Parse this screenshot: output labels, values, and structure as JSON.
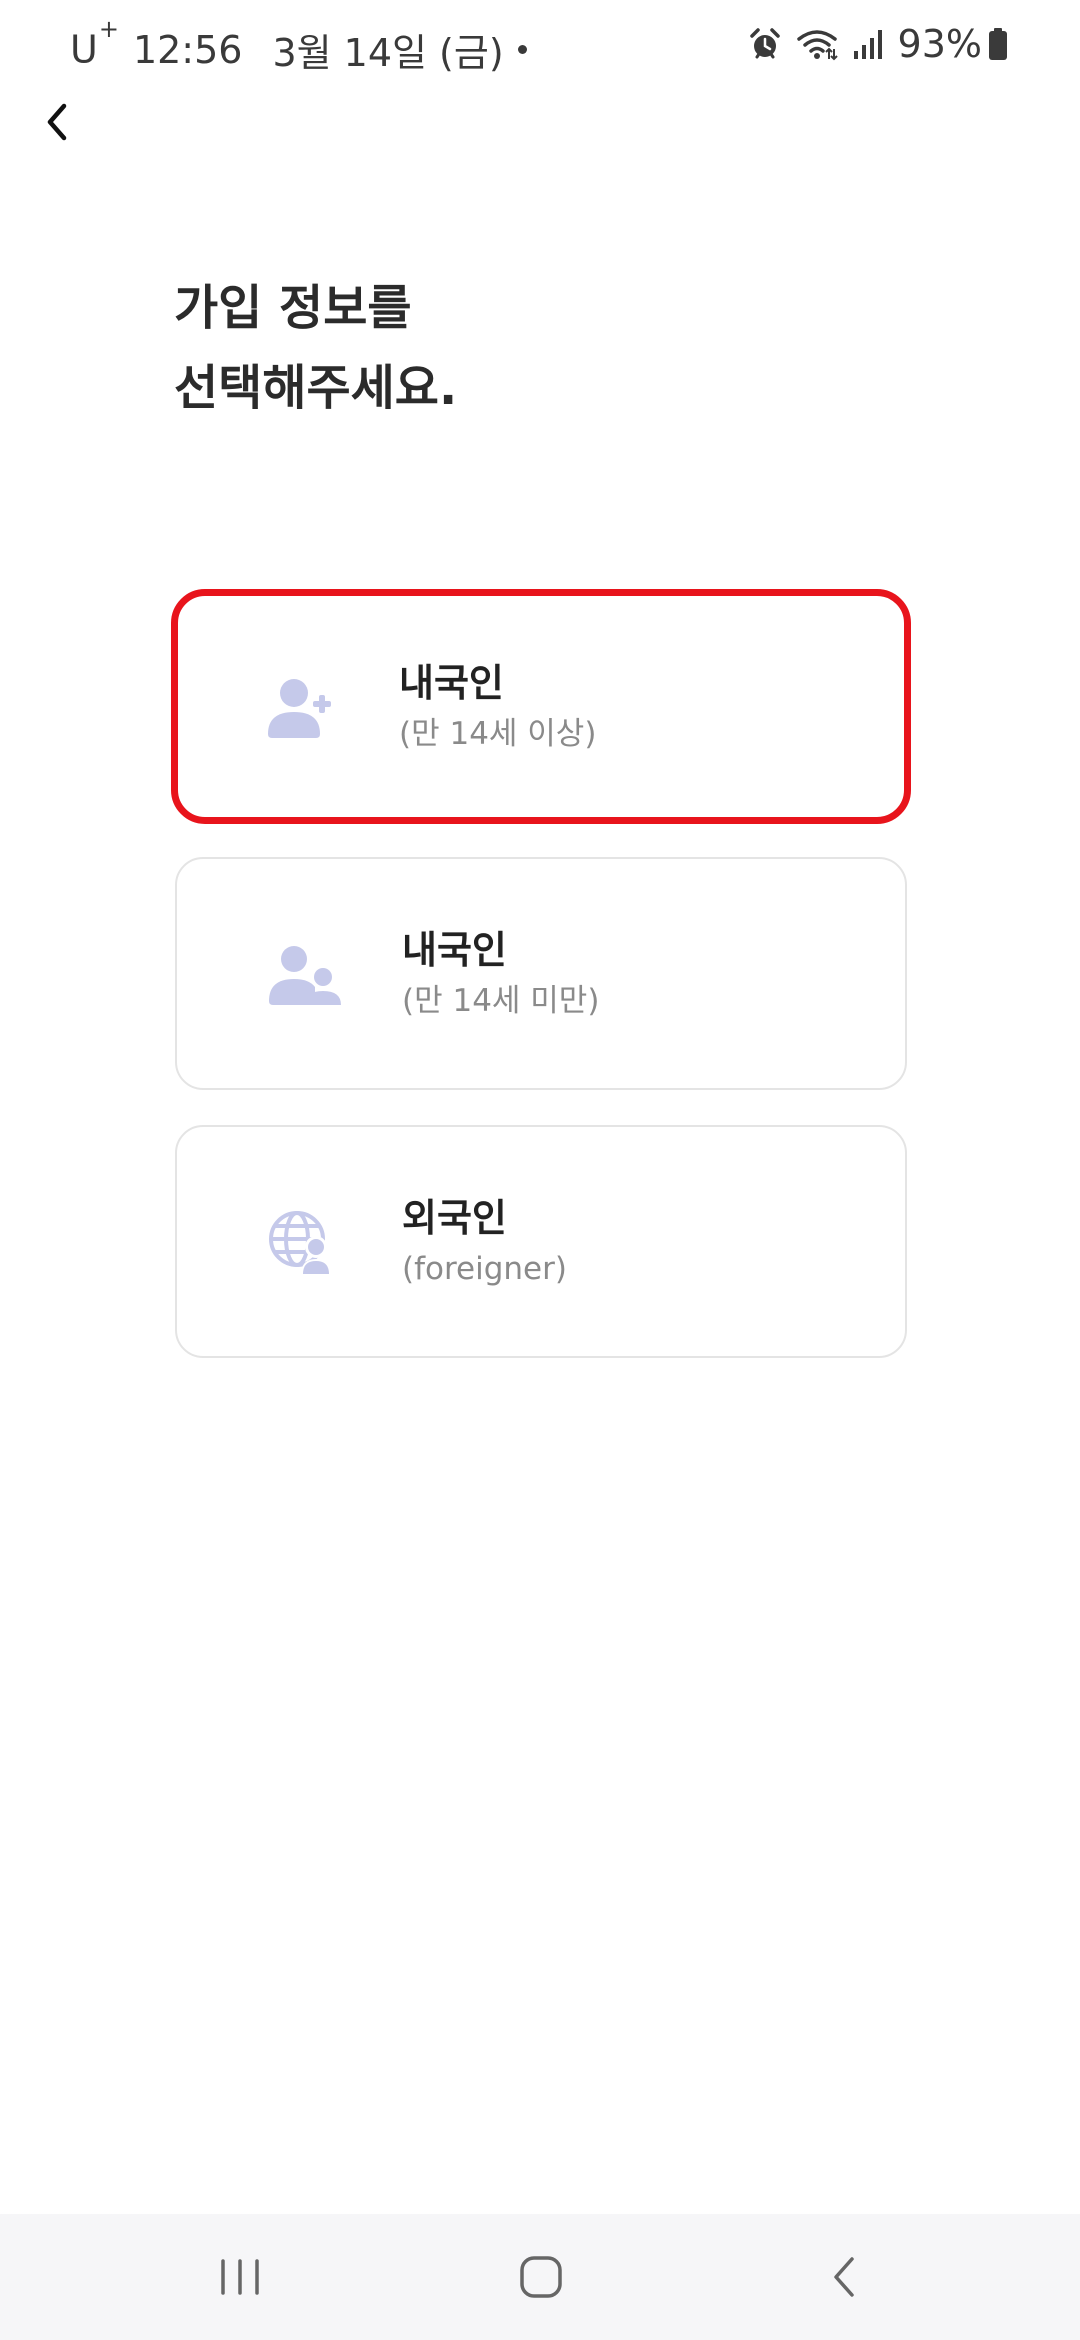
{
  "status_bar": {
    "carrier": "U",
    "carrier_sup": "+",
    "time": "12:56",
    "date": "3월 14일 (금)",
    "battery": "93%",
    "icons": [
      "alarm-icon",
      "wifi-icon",
      "signal-icon",
      "battery-icon"
    ]
  },
  "header": {
    "back_icon": "chevron-left-icon"
  },
  "title": {
    "line1": "가입 정보를",
    "line2": "선택해주세요."
  },
  "options": [
    {
      "title": "내국인",
      "subtitle": "(만 14세 이상)",
      "icon": "user-add-icon",
      "selected": true
    },
    {
      "title": "내국인",
      "subtitle": "(만 14세 미만)",
      "icon": "users-icon",
      "selected": false
    },
    {
      "title": "외국인",
      "subtitle": "(foreigner)",
      "icon": "globe-user-icon",
      "selected": false
    }
  ],
  "colors": {
    "selected_border": "#e8141c",
    "card_border": "#e4e4e4",
    "icon": "#c5c9ea",
    "title_text": "#2b2b2b",
    "subtitle_text": "#8a8a8a"
  },
  "nav_bar": {
    "icons": [
      "recent-apps-icon",
      "home-icon",
      "back-icon"
    ]
  }
}
